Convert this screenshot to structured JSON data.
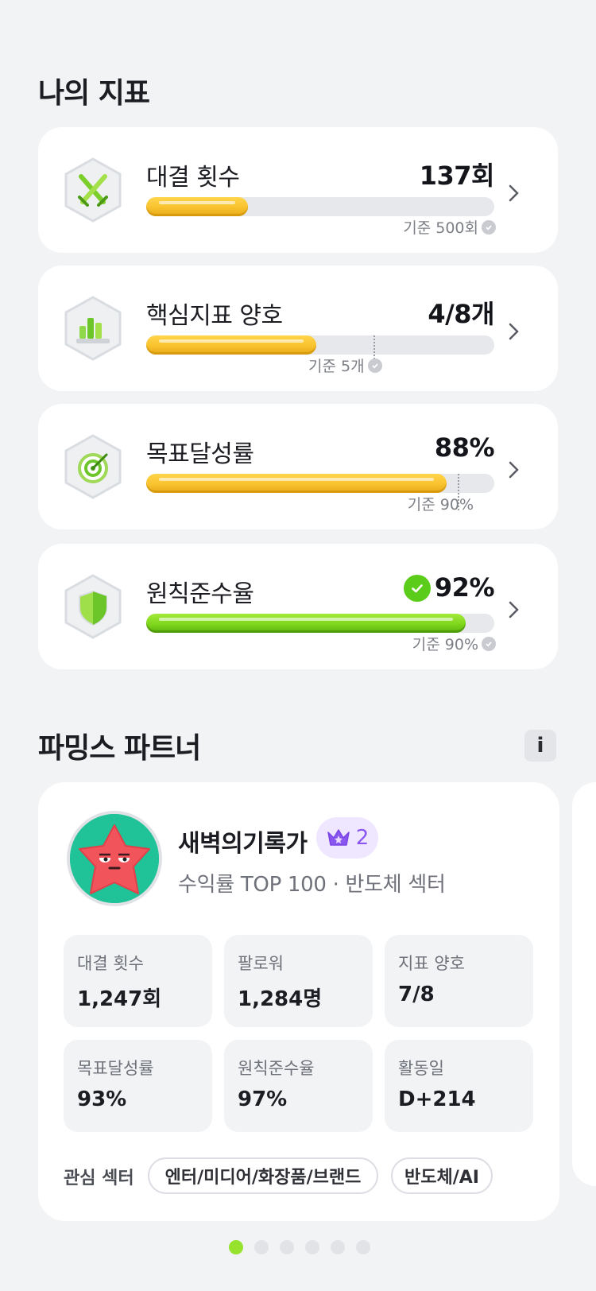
{
  "my_metrics": {
    "title": "나의 지표",
    "items": [
      {
        "name": "대결 횟수",
        "value": "137회",
        "reference": "기준 500회",
        "progress": 0.29,
        "marker": null,
        "color": "yellow",
        "icon": "crossed-swords-icon",
        "achieved": false
      },
      {
        "name": "핵심지표 양호",
        "value": "4/8개",
        "reference": "기준 5개",
        "progress": 0.5,
        "marker": 0.625,
        "color": "yellow",
        "icon": "bar-chart-icon",
        "achieved": false
      },
      {
        "name": "목표달성률",
        "value": "88%",
        "reference": "기준 90%",
        "progress": 0.88,
        "marker": 0.9,
        "color": "yellow",
        "icon": "target-icon",
        "achieved": false
      },
      {
        "name": "원칙준수율",
        "value": "92%",
        "reference": "기준 90%",
        "progress": 0.92,
        "marker": null,
        "color": "green",
        "icon": "shield-icon",
        "achieved": true
      }
    ]
  },
  "partner": {
    "title": "파밍스 파트너",
    "info_icon": "i",
    "name": "새벽의기록가",
    "level": "2",
    "subtitle": "수익률 TOP 100 · 반도체 섹터",
    "stats": [
      {
        "label": "대결 횟수",
        "value": "1,247회"
      },
      {
        "label": "팔로워",
        "value": "1,284명"
      },
      {
        "label": "지표 양호",
        "value": "7/8"
      },
      {
        "label": "목표달성률",
        "value": "93%"
      },
      {
        "label": "원칙준수율",
        "value": "97%"
      },
      {
        "label": "활동일",
        "value": "D+214"
      }
    ],
    "sector_label": "관심 섹터",
    "sectors": [
      "엔터/미디어/화장품/브랜드",
      "반도체/AI"
    ]
  },
  "pagination": {
    "total": 6,
    "active": 1
  },
  "colors": {
    "yellow": "#f9c22e",
    "green": "#7fd61c",
    "accent": "#96e22d",
    "level_purple": "#8a56f0"
  }
}
